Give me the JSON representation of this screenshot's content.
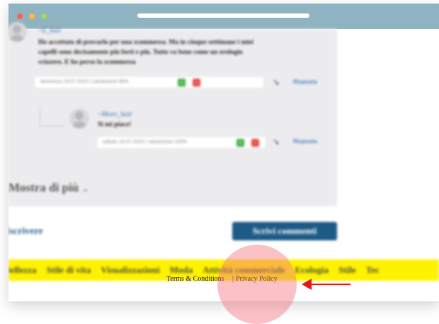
{
  "window": {
    "controls": [
      "close",
      "minimize",
      "maximize"
    ]
  },
  "comments": [
    {
      "username": "~li_hair",
      "text_lines": [
        "Ho accettato di provarlo per una scommessa. Ma in cinque settimane i miei",
        "capelli sono decisamente più forti e più. Tutto va bene come un orologio",
        "svizzero. E ho perso la scommessa"
      ],
      "meta": "domenica 19.07.2020 | valutazione 98%",
      "reply_label": "Risposta"
    },
    {
      "username": "~Moro_hair",
      "text_lines": [
        "Si mi piace!"
      ],
      "meta": "sabato 18.07.2020 | valutazione 100%",
      "reply_label": "Risposta"
    }
  ],
  "show_more": "Mostra di più",
  "subscribe": "Iscrivere",
  "write_comment": "Scrivi commenti",
  "categories": [
    "Bellezza",
    "Stile di vita",
    "Visualizzazioni",
    "Moda",
    "Attività commerciale",
    "Ecologia",
    "Stile",
    "Tec"
  ],
  "footer": {
    "terms": "Terms & Conditions",
    "separator": "|",
    "privacy": "Privacy Policy"
  },
  "colors": {
    "titlebar": "#8fb3c0",
    "category_bar": "#fff200",
    "primary_button": "#1c5b86",
    "highlight": "#f47882",
    "arrow": "#e8141c"
  }
}
